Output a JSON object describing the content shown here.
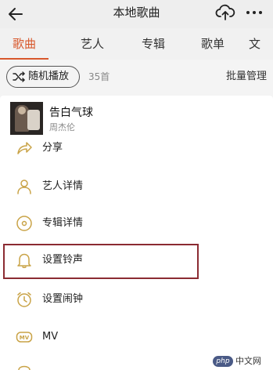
{
  "header": {
    "title": "本地歌曲",
    "back_icon": "arrow-left-icon",
    "cloud_icon": "cloud-upload-icon",
    "more_icon": "more-horizontal-icon"
  },
  "tabs": [
    {
      "label": "歌曲",
      "active": true
    },
    {
      "label": "艺人",
      "active": false
    },
    {
      "label": "专辑",
      "active": false
    },
    {
      "label": "歌单",
      "active": false
    },
    {
      "label": "文",
      "active": false
    }
  ],
  "toolbar": {
    "shuffle_label": "随机播放",
    "song_count": "35首",
    "batch_manage": "批量管理"
  },
  "sheet": {
    "song_title": "告白气球",
    "song_artist": "周杰伦",
    "menu_items": [
      {
        "label": "分享",
        "icon": "share-icon"
      },
      {
        "label": "艺人详情",
        "icon": "person-icon"
      },
      {
        "label": "专辑详情",
        "icon": "disc-icon"
      },
      {
        "label": "设置铃声",
        "icon": "bell-icon",
        "highlighted": true
      },
      {
        "label": "设置闹钟",
        "icon": "alarm-clock-icon"
      },
      {
        "label": "MV",
        "icon": "mv-icon"
      }
    ]
  },
  "watermark": {
    "logo": "php",
    "text": "中文网"
  },
  "colors": {
    "accent": "#d8582c",
    "highlight_border": "#8b2b32"
  }
}
